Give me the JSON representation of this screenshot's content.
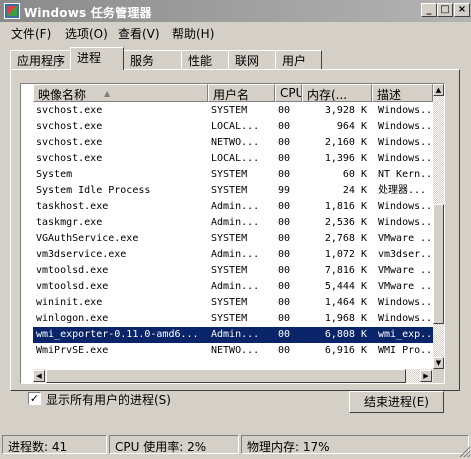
{
  "window": {
    "title": "Windows 任务管理器"
  },
  "menu": [
    "文件(F)",
    "选项(O)",
    "查看(V)",
    "帮助(H)"
  ],
  "tabs": [
    "应用程序",
    "进程",
    "服务",
    "性能",
    "联网",
    "用户"
  ],
  "active_tab": "进程",
  "columns": {
    "name": "映像名称",
    "user": "用户名",
    "cpu": "CPU",
    "mem": "内存(...",
    "desc": "描述"
  },
  "processes": [
    {
      "name": "svchost.exe",
      "user": "SYSTEM",
      "cpu": "00",
      "mem": "3,928 K",
      "desc": "Windows..."
    },
    {
      "name": "svchost.exe",
      "user": "LOCAL...",
      "cpu": "00",
      "mem": "964 K",
      "desc": "Windows..."
    },
    {
      "name": "svchost.exe",
      "user": "NETWO...",
      "cpu": "00",
      "mem": "2,160 K",
      "desc": "Windows..."
    },
    {
      "name": "svchost.exe",
      "user": "LOCAL...",
      "cpu": "00",
      "mem": "1,396 K",
      "desc": "Windows..."
    },
    {
      "name": "System",
      "user": "SYSTEM",
      "cpu": "00",
      "mem": "60 K",
      "desc": "NT Kern..."
    },
    {
      "name": "System Idle Process",
      "user": "SYSTEM",
      "cpu": "99",
      "mem": "24 K",
      "desc": "处理器..."
    },
    {
      "name": "taskhost.exe",
      "user": "Admin...",
      "cpu": "00",
      "mem": "1,816 K",
      "desc": "Windows..."
    },
    {
      "name": "taskmgr.exe",
      "user": "Admin...",
      "cpu": "00",
      "mem": "2,536 K",
      "desc": "Windows..."
    },
    {
      "name": "VGAuthService.exe",
      "user": "SYSTEM",
      "cpu": "00",
      "mem": "2,768 K",
      "desc": "VMware ..."
    },
    {
      "name": "vm3dservice.exe",
      "user": "Admin...",
      "cpu": "00",
      "mem": "1,072 K",
      "desc": "vm3dser..."
    },
    {
      "name": "vmtoolsd.exe",
      "user": "SYSTEM",
      "cpu": "00",
      "mem": "7,816 K",
      "desc": "VMware ..."
    },
    {
      "name": "vmtoolsd.exe",
      "user": "Admin...",
      "cpu": "00",
      "mem": "5,444 K",
      "desc": "VMware ..."
    },
    {
      "name": "wininit.exe",
      "user": "SYSTEM",
      "cpu": "00",
      "mem": "1,464 K",
      "desc": "Windows..."
    },
    {
      "name": "winlogon.exe",
      "user": "SYSTEM",
      "cpu": "00",
      "mem": "1,968 K",
      "desc": "Windows..."
    },
    {
      "name": "wmi_exporter-0.11.0-amd6...",
      "user": "Admin...",
      "cpu": "00",
      "mem": "6,808 K",
      "desc": "wmi_exp..."
    },
    {
      "name": "WmiPrvSE.exe",
      "user": "NETWO...",
      "cpu": "00",
      "mem": "6,916 K",
      "desc": "WMI Pro..."
    }
  ],
  "selected_row": "wmi_exporter-0.11.0-amd6...",
  "show_all_users": {
    "label": "显示所有用户的进程(S)",
    "checked": true
  },
  "end_process_button": "结束进程(E)",
  "status": {
    "process_count": "进程数: 41",
    "cpu_usage": "CPU 使用率: 2%",
    "physical_memory": "物理内存: 17%"
  }
}
